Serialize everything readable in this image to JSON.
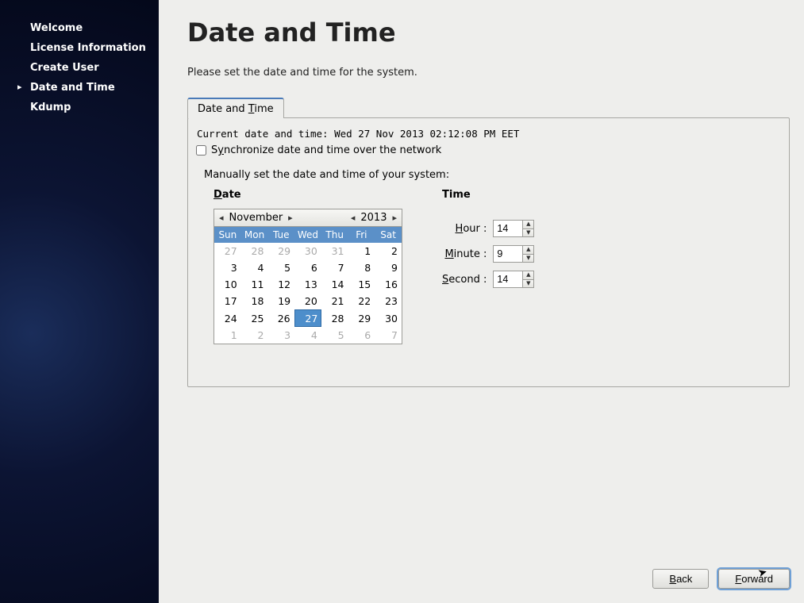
{
  "sidebar": {
    "items": [
      {
        "label": "Welcome"
      },
      {
        "label": "License Information"
      },
      {
        "label": "Create User"
      },
      {
        "label": "Date and Time"
      },
      {
        "label": "Kdump"
      }
    ],
    "activeIndex": 3
  },
  "page": {
    "title": "Date and Time",
    "subtitle": "Please set the date and time for the system."
  },
  "tab": {
    "label_pre": "Date and ",
    "label_u": "T",
    "label_post": "ime"
  },
  "panel": {
    "current_label": "Current date and time:",
    "current_value": "Wed 27 Nov 2013 02:12:08 PM EET",
    "sync_pre": "S",
    "sync_u": "y",
    "sync_post": "nchronize date and time over the network",
    "sync_checked": false,
    "manual_label": "Manually set the date and time of your system:"
  },
  "date": {
    "header_u": "D",
    "header_post": "ate",
    "month": "November",
    "year": "2013",
    "weekdays": [
      "Sun",
      "Mon",
      "Tue",
      "Wed",
      "Thu",
      "Fri",
      "Sat"
    ],
    "rows": [
      [
        {
          "d": 27,
          "o": true
        },
        {
          "d": 28,
          "o": true
        },
        {
          "d": 29,
          "o": true
        },
        {
          "d": 30,
          "o": true
        },
        {
          "d": 31,
          "o": true
        },
        {
          "d": 1
        },
        {
          "d": 2
        }
      ],
      [
        {
          "d": 3
        },
        {
          "d": 4
        },
        {
          "d": 5
        },
        {
          "d": 6
        },
        {
          "d": 7
        },
        {
          "d": 8
        },
        {
          "d": 9
        }
      ],
      [
        {
          "d": 10
        },
        {
          "d": 11
        },
        {
          "d": 12
        },
        {
          "d": 13
        },
        {
          "d": 14
        },
        {
          "d": 15
        },
        {
          "d": 16
        }
      ],
      [
        {
          "d": 17
        },
        {
          "d": 18
        },
        {
          "d": 19
        },
        {
          "d": 20
        },
        {
          "d": 21
        },
        {
          "d": 22
        },
        {
          "d": 23
        }
      ],
      [
        {
          "d": 24
        },
        {
          "d": 25
        },
        {
          "d": 26
        },
        {
          "d": 27,
          "sel": true
        },
        {
          "d": 28
        },
        {
          "d": 29
        },
        {
          "d": 30
        }
      ],
      [
        {
          "d": 1,
          "o": true
        },
        {
          "d": 2,
          "o": true
        },
        {
          "d": 3,
          "o": true
        },
        {
          "d": 4,
          "o": true
        },
        {
          "d": 5,
          "o": true
        },
        {
          "d": 6,
          "o": true
        },
        {
          "d": 7,
          "o": true
        }
      ]
    ]
  },
  "time": {
    "header": "Time",
    "hour_u": "H",
    "hour_post": "our :",
    "hour_value": "14",
    "minute_u": "M",
    "minute_post": "inute :",
    "minute_value": "9",
    "second_u": "S",
    "second_post": "econd :",
    "second_value": "14"
  },
  "footer": {
    "back_u": "B",
    "back_post": "ack",
    "forward_u": "F",
    "forward_post": "orward"
  }
}
